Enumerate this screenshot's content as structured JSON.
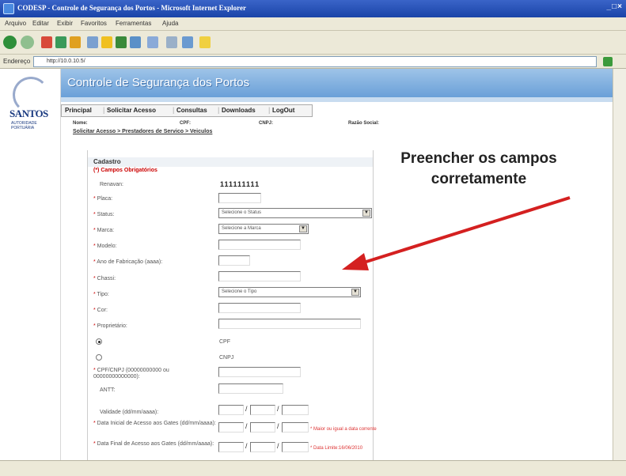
{
  "window": {
    "title": "CODESP - Controle de Segurança dos Portos - Microsoft Internet Explorer",
    "controls": "_□×"
  },
  "menu": [
    "Arquivo",
    "Editar",
    "Exibir",
    "Favoritos",
    "Ferramentas",
    "Ajuda"
  ],
  "address": {
    "label": "Endereço",
    "url": "http://10.0.10.5/"
  },
  "logo": {
    "name": "SANTOS",
    "subtitle": "AUTORIDADE PORTUÁRIA"
  },
  "header": {
    "title": "Controle de Segurança dos Portos"
  },
  "nav": {
    "items": [
      "Principal",
      "Solicitar Acesso",
      "Consultas",
      "Downloads",
      "LogOut"
    ]
  },
  "info": {
    "nome": "Nome:",
    "cpf": "CPF:",
    "cnpj": "CNPJ:",
    "razao": "Razão Social:"
  },
  "breadcrumb": "Solicitar Acesso > Prestadores de Servico > Veiculos",
  "form": {
    "title": "Cadastro",
    "required_note": "(*) Campos Obrigatórios",
    "renavan_label": "Renavan:",
    "renavan_value": "111111111",
    "placa_label": "Placa:",
    "status_label": "Status:",
    "status_value": "Selecione o Status",
    "marca_label": "Marca:",
    "marca_value": "Selecione a Marca",
    "modelo_label": "Modelo:",
    "ano_label": "Ano de Fabricação (aaaa):",
    "chassi_label": "Chassi:",
    "tipo_label": "Tipo:",
    "tipo_value": "Selecione o Tipo",
    "cor_label": "Cor:",
    "proprietario_label": "Proprietário:",
    "cpf_option": "CPF",
    "cnpj_option": "CNPJ",
    "cpf_cnpj_label": "CPF/CNPJ (00000000000 ou 00000000000000):",
    "antt_label": "ANTT:",
    "validade_label": "Validade (dd/mm/aaaa):",
    "data_inicial_label": "Data Inicial de Acesso aos Gates (dd/mm/aaaa):",
    "data_inicial_note": "* Maior ou igual a data corrente",
    "data_final_label": "Data Final de Acesso aos Gates (dd/mm/aaaa):",
    "data_final_note": "* Data Limite:16/06/2010"
  },
  "annotation": {
    "line1": "Preencher os campos",
    "line2": "corretamente"
  },
  "colors": {
    "arrow": "#d42020",
    "header": "#7aaee0",
    "required": "#cc0000"
  }
}
